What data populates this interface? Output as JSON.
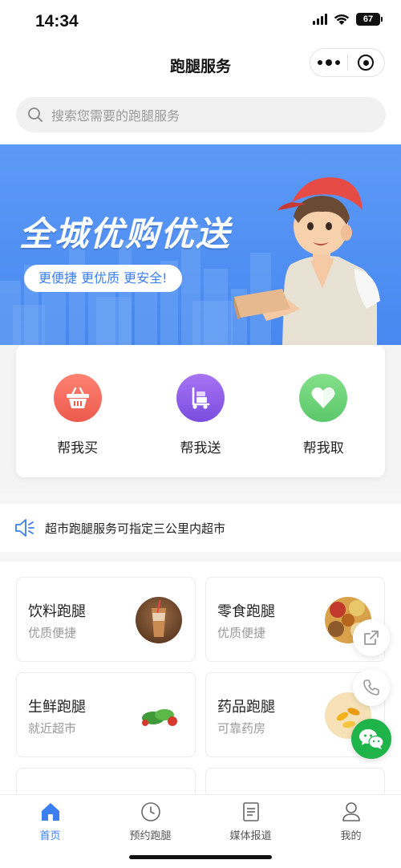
{
  "status_bar": {
    "time": "14:34",
    "battery": "67"
  },
  "nav": {
    "title": "跑腿服务"
  },
  "search": {
    "placeholder": "搜索您需要的跑腿服务"
  },
  "banner": {
    "headline": "全城优购优送",
    "tagline": "更便捷 更优质 更安全!"
  },
  "services": [
    {
      "label": "帮我买",
      "icon": "shopping-basket-icon",
      "color": "#f26a5c"
    },
    {
      "label": "帮我送",
      "icon": "hand-truck-icon",
      "color": "#8a5ae8"
    },
    {
      "label": "帮我取",
      "icon": "heart-icon",
      "color": "#6fd27a"
    }
  ],
  "notice": {
    "text": "超市跑腿服务可指定三公里内超市"
  },
  "categories": [
    {
      "title": "饮料跑腿",
      "subtitle": "优质便捷"
    },
    {
      "title": "零食跑腿",
      "subtitle": "优质便捷"
    },
    {
      "title": "生鲜跑腿",
      "subtitle": "就近超市"
    },
    {
      "title": "药品跑腿",
      "subtitle": "可靠药房"
    }
  ],
  "tabs": [
    {
      "label": "首页",
      "icon": "home-icon",
      "active": true
    },
    {
      "label": "预约跑腿",
      "icon": "clock-icon",
      "active": false
    },
    {
      "label": "媒体报道",
      "icon": "document-icon",
      "active": false
    },
    {
      "label": "我的",
      "icon": "user-icon",
      "active": false
    }
  ],
  "colors": {
    "accent": "#3a7ef0",
    "banner": "#5d9af7",
    "wechat": "#1fb44a"
  }
}
